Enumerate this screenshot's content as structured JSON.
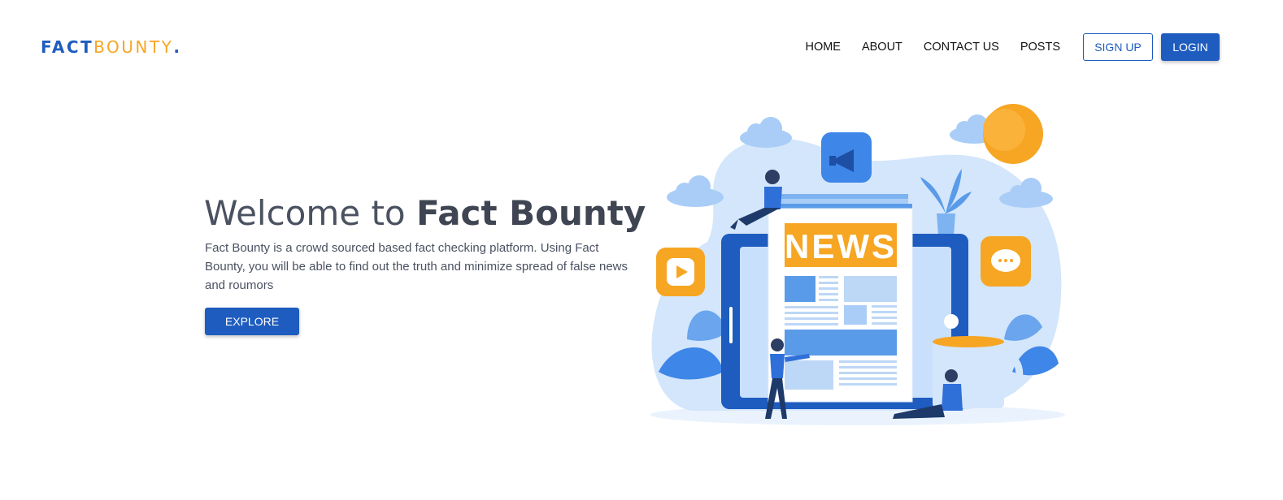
{
  "header": {
    "logo": {
      "part1": "FACT",
      "part2": "BOUNTY",
      "dot": "."
    },
    "nav": [
      {
        "label": "HOME"
      },
      {
        "label": "ABOUT"
      },
      {
        "label": "CONTACT US"
      },
      {
        "label": "POSTS"
      }
    ],
    "signup_label": "SIGN UP",
    "login_label": "LOGIN"
  },
  "hero": {
    "title_prefix": "Welcome to ",
    "title_bold": "Fact Bounty",
    "description": "Fact Bounty is a crowd sourced based fact checking platform. Using Fact Bounty, you will be able to find out the truth and minimize spread of false news and roumors",
    "explore_label": "EXPLORE",
    "illustration": {
      "newspaper_heading": "NEWS",
      "colors": {
        "brand_blue": "#1e5cbf",
        "accent_orange": "#f6a623",
        "light_blue": "#d4e6fb"
      }
    }
  }
}
